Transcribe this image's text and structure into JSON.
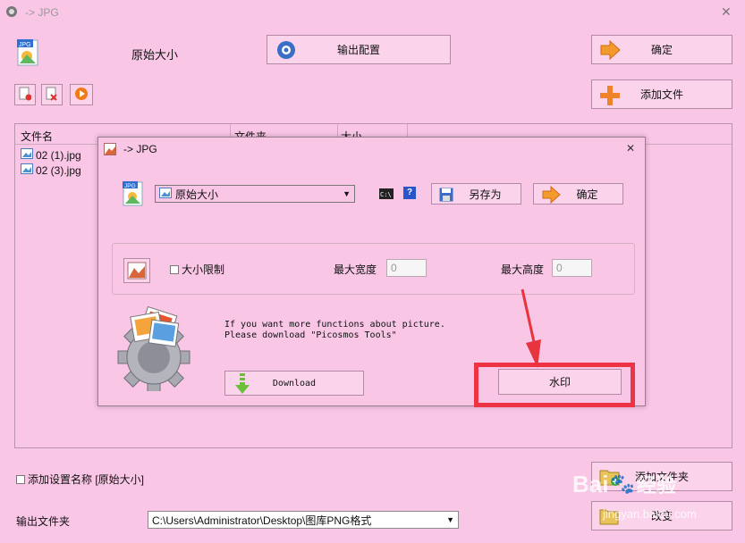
{
  "window": {
    "title": "-> JPG"
  },
  "top": {
    "preset_label": "原始大小",
    "output_config_button": "输出配置",
    "confirm_button": "确定",
    "add_file_button": "添加文件"
  },
  "file_list": {
    "columns": [
      "文件名",
      "文件夹",
      "大小"
    ],
    "rows": [
      "02 (1).jpg",
      "02 (3).jpg"
    ]
  },
  "dialog": {
    "title": "-> JPG",
    "preset_value": "原始大小",
    "save_as_button": "另存为",
    "confirm_button": "确定",
    "size_limit_label": "大小限制",
    "max_width_label": "最大宽度",
    "max_width_value": "0",
    "max_height_label": "最大高度",
    "max_height_value": "0",
    "promo_line1": "If you want more functions about picture.",
    "promo_line2": "Please download \"Picosmos Tools\"",
    "download_button": "Download",
    "watermark_button": "水印"
  },
  "bottom": {
    "add_setting_name_label": "添加设置名称 [原始大小]",
    "add_folder_button": "添加文件夹",
    "change_button": "改变",
    "output_folder_label": "输出文件夹",
    "output_folder_path": "C:\\Users\\Administrator\\Desktop\\图库PNG格式"
  },
  "watermark_text": {
    "logo": "Bai",
    "logo_suffix": "经验",
    "url": "jingyan.baidu.com"
  },
  "colors": {
    "background": "#f9c6e6",
    "highlight_box": "#ee3344",
    "arrow": "#e8343c"
  }
}
